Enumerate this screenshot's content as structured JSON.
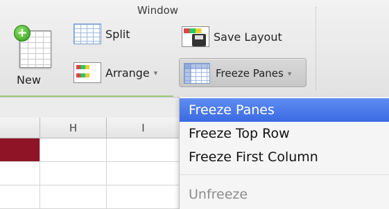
{
  "ribbon": {
    "group_title": "Window",
    "new_label": "New",
    "split_label": "Split",
    "arrange_label": "Arrange",
    "save_layout_label": "Save Layout",
    "freeze_panes_label": "Freeze Panes"
  },
  "grid": {
    "columns": [
      "H",
      "I"
    ]
  },
  "menu": {
    "items": [
      {
        "label": "Freeze Panes",
        "state": "highlighted"
      },
      {
        "label": "Freeze Top Row",
        "state": "enabled"
      },
      {
        "label": "Freeze First Column",
        "state": "enabled"
      },
      {
        "label": "Unfreeze",
        "state": "disabled"
      }
    ]
  },
  "colors": {
    "menu_highlight": "#3f6fe4",
    "selected_cell": "#8f1426"
  }
}
